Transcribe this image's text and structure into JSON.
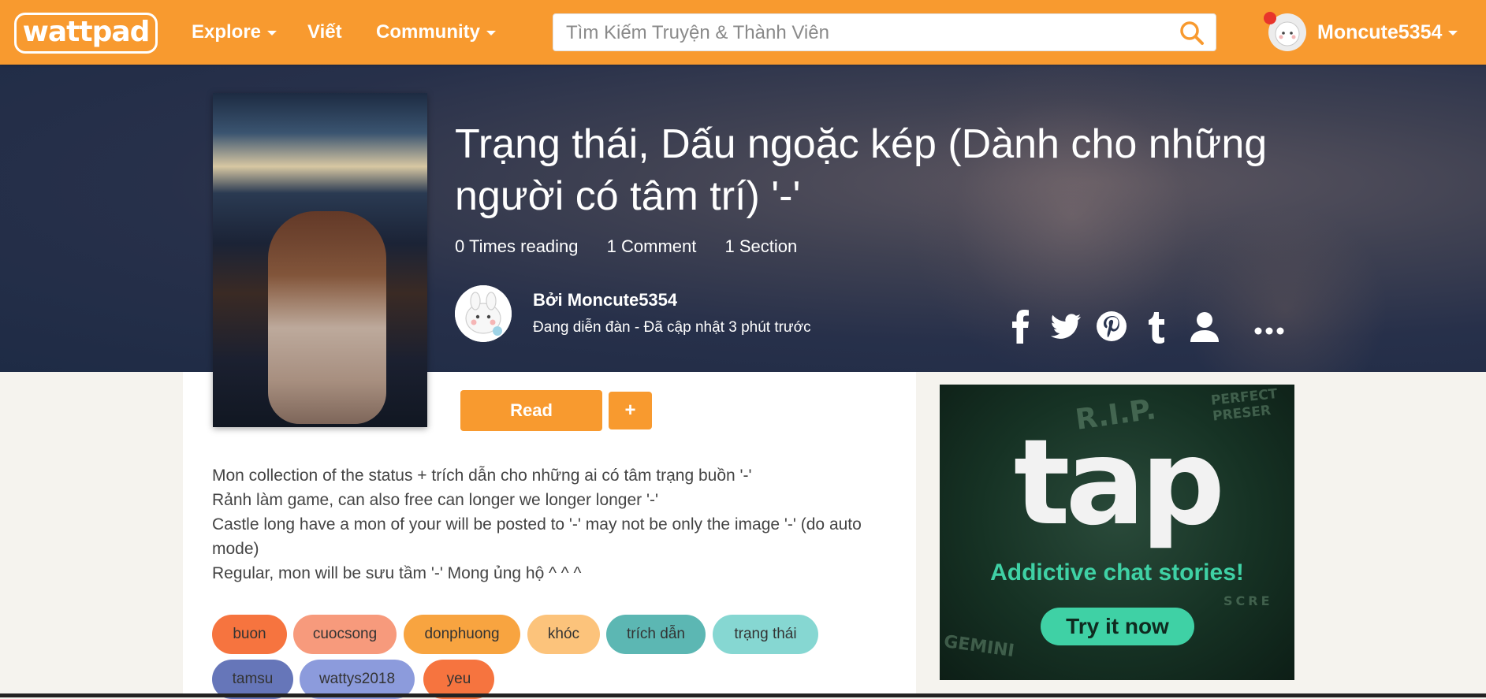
{
  "nav": {
    "logo": "wattpad",
    "explore": "Explore",
    "write": "Viết",
    "community": "Community",
    "search_placeholder": "Tìm Kiếm Truyện & Thành Viên",
    "username": "Moncute5354"
  },
  "story": {
    "title": "Trạng thái, Dấu ngoặc kép (Dành cho những người có tâm trí) '-'",
    "stats": {
      "reads": "0 Times reading",
      "comments": "1 Comment",
      "sections": "1 Section"
    },
    "author": "Bởi Moncute5354",
    "meta": "Đang diễn đàn - Đã cập nhật 3 phút trước",
    "read_label": "Read",
    "add_label": "+",
    "description": [
      "Mon collection of the status + trích dẫn cho những ai có tâm trạng buồn '-'",
      "Rảnh làm game, can also free can longer we longer longer '-'",
      "Castle long have a mon of your will be posted to '-' may not be only the image '-' (do auto mode)",
      "Regular, mon will be sưu tầm '-' Mong ủng hộ ^ ^ ^"
    ],
    "tags": [
      {
        "label": "buon",
        "color": "#f6743f"
      },
      {
        "label": "cuocsong",
        "color": "#f79a7c"
      },
      {
        "label": "donphuong",
        "color": "#f8a440"
      },
      {
        "label": "khóc",
        "color": "#fcc37b"
      },
      {
        "label": "trích dẫn",
        "color": "#5cb7b3"
      },
      {
        "label": "trạng thái",
        "color": "#86d7d2"
      },
      {
        "label": "tamsu",
        "color": "#6676b9"
      },
      {
        "label": "wattys2018",
        "color": "#8c9bdc"
      },
      {
        "label": "yeu",
        "color": "#f6743f"
      }
    ]
  },
  "share": [
    "facebook-icon",
    "twitter-icon",
    "pinterest-icon",
    "tumblr-icon",
    "profile-icon",
    "more-icon"
  ],
  "ad": {
    "brand": "tap",
    "tagline": "Addictive chat stories!",
    "cta": "Try it now",
    "deco": [
      "R.I.P.",
      "PERFECT PRESER",
      "GEMINI",
      "SCRE"
    ]
  },
  "colors": {
    "brand_orange": "#f89a2f",
    "ad_green": "#3fd1a5"
  }
}
